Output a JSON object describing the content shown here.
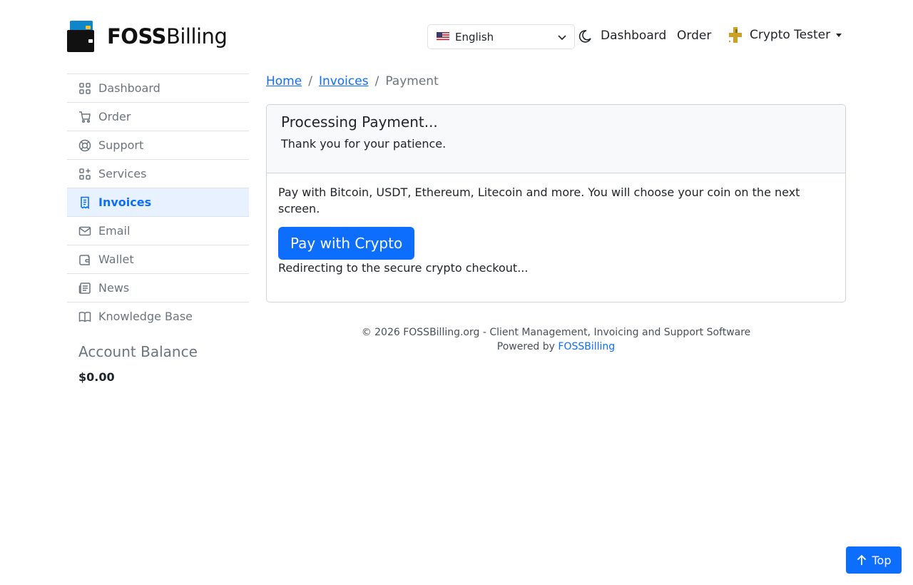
{
  "brand": {
    "name_bold": "FOSS",
    "name_light": "Billing"
  },
  "header": {
    "language": "English",
    "nav": [
      "Dashboard",
      "Order"
    ],
    "user": "Crypto Tester"
  },
  "sidebar": {
    "items": [
      {
        "label": "Dashboard",
        "icon": "dashboard-icon"
      },
      {
        "label": "Order",
        "icon": "cart-icon"
      },
      {
        "label": "Support",
        "icon": "lifebuoy-icon"
      },
      {
        "label": "Services",
        "icon": "apps-icon"
      },
      {
        "label": "Invoices",
        "icon": "receipt-icon",
        "active": true
      },
      {
        "label": "Email",
        "icon": "mail-icon"
      },
      {
        "label": "Wallet",
        "icon": "wallet-icon"
      },
      {
        "label": "News",
        "icon": "news-icon"
      },
      {
        "label": "Knowledge Base",
        "icon": "book-icon"
      }
    ],
    "balance_title": "Account Balance",
    "balance_amount": "$0.00"
  },
  "breadcrumb": {
    "home": "Home",
    "invoices": "Invoices",
    "current": "Payment",
    "sep": "/"
  },
  "card": {
    "title": "Processing Payment...",
    "subtitle": "Thank you for your patience.",
    "description": "Pay with Bitcoin, USDT, Ethereum, Litecoin and more. You will choose your coin on the next screen.",
    "button": "Pay with Crypto",
    "redirect": "Redirecting to the secure crypto checkout..."
  },
  "footer": {
    "line1": "© 2026 FOSSBilling.org - Client Management, Invoicing and Support Software",
    "powered_prefix": "Powered by",
    "powered_link": "FOSSBilling"
  },
  "top_button": "Top",
  "colors": {
    "accent": "#0d6efd",
    "active_bg": "#e7f1ff",
    "muted": "#6c757d"
  }
}
